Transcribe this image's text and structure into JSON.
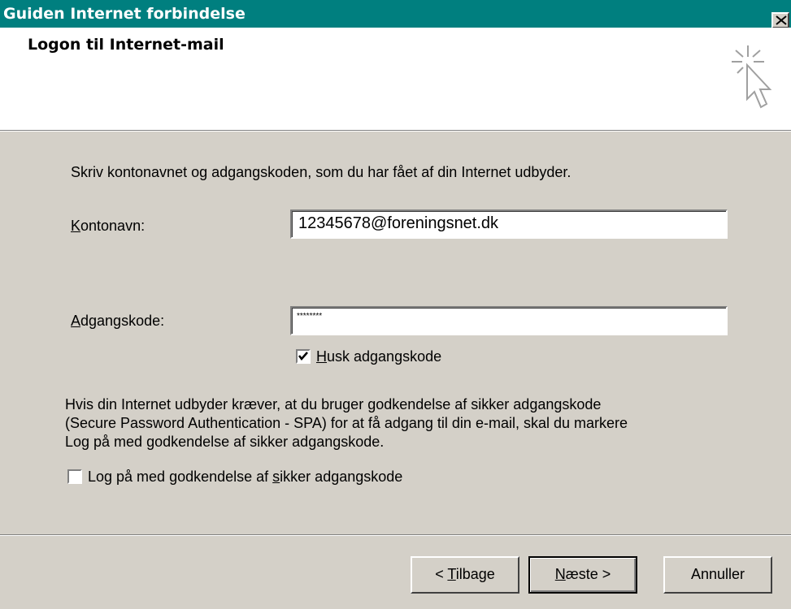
{
  "window": {
    "title": "Guiden Internet forbindelse"
  },
  "header": {
    "title": "Logon til Internet-mail",
    "icon": "wizard-cursor-sparkle-icon"
  },
  "intro_text": "Skriv kontonavnet og adgangskoden, som du har fået af din Internet udbyder.",
  "account": {
    "label_accel": "K",
    "label_rest": "ontonavn:",
    "value": "12345678@foreningsnet.dk"
  },
  "password": {
    "label_accel": "A",
    "label_rest": "dgangskode:",
    "value_masked": "********"
  },
  "remember": {
    "label_accel": "H",
    "label_rest": "usk adgangskode",
    "checked": true
  },
  "spa_info": {
    "line1": "Hvis din Internet udbyder kræver, at du bruger godkendelse af sikker adgangskode",
    "line2": "(Secure Password Authentication - SPA) for at få adgang til din e-mail, skal du markere",
    "line3": "Log på med godkendelse af sikker adgangskode."
  },
  "spa_checkbox": {
    "label_pre": "Log på med godkendelse af ",
    "label_accel": "s",
    "label_post": "ikker adgangskode",
    "checked": false
  },
  "buttons": {
    "back_pre": "< ",
    "back_accel": "T",
    "back_rest": "ilbage",
    "next_accel": "N",
    "next_rest": "æste >",
    "cancel": "Annuller"
  },
  "colors": {
    "titlebar": "#007f7f",
    "dialog": "#d4d0c8",
    "header_bg": "#ffffff"
  }
}
